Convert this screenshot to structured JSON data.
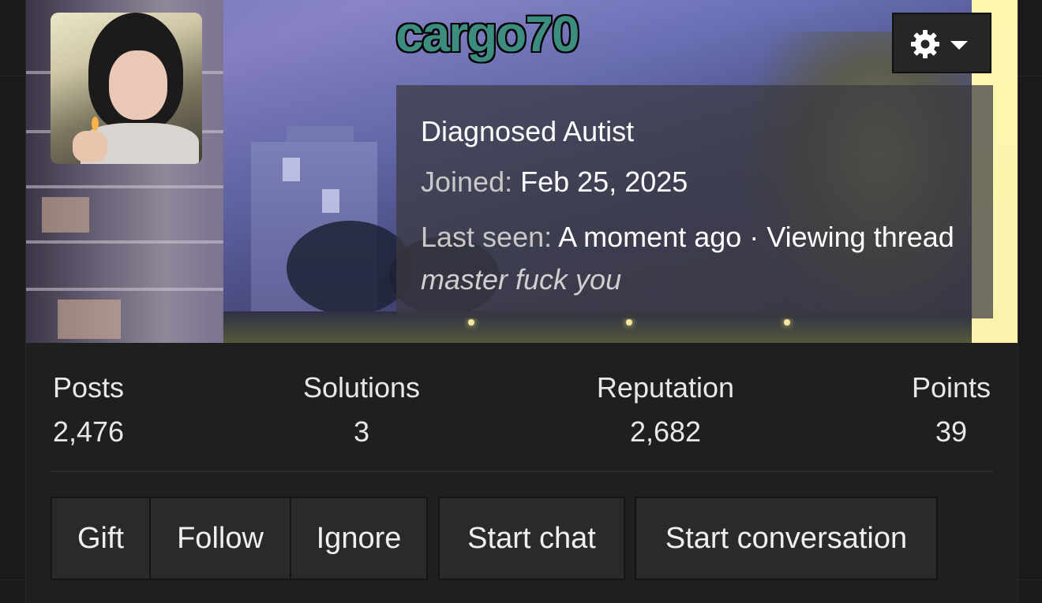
{
  "profile": {
    "username": "cargo70",
    "custom_title": "Diagnosed Autist",
    "joined_label": "Joined:",
    "joined_value": "Feb 25, 2025",
    "last_seen_label": "Last seen:",
    "last_seen_value": "A moment ago · Viewing thread",
    "last_seen_thread": "master fuck you",
    "username_color": "#3c8c80"
  },
  "stats": [
    {
      "label": "Posts",
      "value": "2,476"
    },
    {
      "label": "Solutions",
      "value": "3"
    },
    {
      "label": "Reputation",
      "value": "2,682"
    },
    {
      "label": "Points",
      "value": "39"
    }
  ],
  "actions": {
    "gift": "Gift",
    "follow": "Follow",
    "ignore": "Ignore",
    "start_chat": "Start chat",
    "start_conversation": "Start conversation"
  },
  "icons": {
    "settings": "gear-icon",
    "menu": "caret-down-icon"
  }
}
